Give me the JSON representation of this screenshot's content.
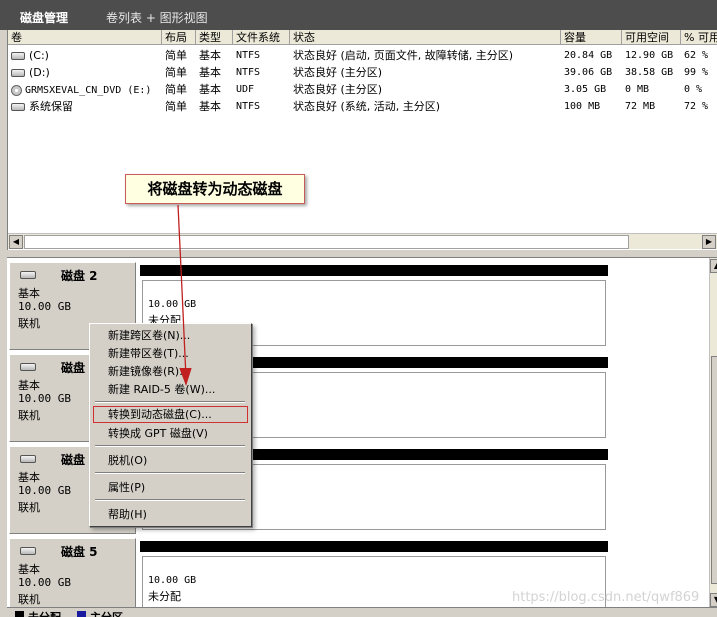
{
  "titlebar": {
    "title": "磁盘管理",
    "views": "卷列表 + 图形视图"
  },
  "columns": [
    "卷",
    "布局",
    "类型",
    "文件系统",
    "状态",
    "容量",
    "可用空间",
    "% 可用"
  ],
  "volumes": [
    {
      "icon": "drive-icon",
      "name": "(C:)",
      "layout": "简单",
      "type": "基本",
      "fs": "NTFS",
      "status": "状态良好 (启动, 页面文件, 故障转储, 主分区)",
      "capacity": "20.84 GB",
      "free": "12.90 GB",
      "pct": "62 %"
    },
    {
      "icon": "drive-icon",
      "name": "(D:)",
      "layout": "简单",
      "type": "基本",
      "fs": "NTFS",
      "status": "状态良好 (主分区)",
      "capacity": "39.06 GB",
      "free": "38.58 GB",
      "pct": "99 %"
    },
    {
      "icon": "cd-icon",
      "name": "GRMSXEVAL_CN_DVD (E:)",
      "layout": "简单",
      "type": "基本",
      "fs": "UDF",
      "status": "状态良好 (主分区)",
      "capacity": "3.05 GB",
      "free": "0 MB",
      "pct": "0 %"
    },
    {
      "icon": "drive-icon",
      "name": "系统保留",
      "layout": "简单",
      "type": "基本",
      "fs": "NTFS",
      "status": "状态良好 (系统, 活动, 主分区)",
      "capacity": "100 MB",
      "free": "72 MB",
      "pct": "72 %"
    }
  ],
  "callout": "将磁盘转为动态磁盘",
  "disks": [
    {
      "name": "磁盘 2",
      "kind": "基本",
      "size": "10.00 GB",
      "state": "联机",
      "part_size": "10.00 GB",
      "part_state": "未分配"
    },
    {
      "name": "磁盘 3",
      "kind": "基本",
      "size": "10.00 GB",
      "state": "联机",
      "part_size": "",
      "part_state": ""
    },
    {
      "name": "磁盘 4",
      "kind": "基本",
      "size": "10.00 GB",
      "state": "联机",
      "part_size": "",
      "part_state": ""
    },
    {
      "name": "磁盘 5",
      "kind": "基本",
      "size": "10.00 GB",
      "state": "联机",
      "part_size": "10.00 GB",
      "part_state": "未分配"
    }
  ],
  "context_menu": {
    "new_spanned": "新建跨区卷(N)...",
    "new_striped": "新建带区卷(T)...",
    "new_mirrored": "新建镜像卷(R)...",
    "new_raid5": "新建 RAID-5 卷(W)...",
    "convert_dynamic": "转换到动态磁盘(C)...",
    "convert_gpt": "转换成 GPT 磁盘(V)",
    "offline": "脱机(O)",
    "properties": "属性(P)",
    "help": "帮助(H)"
  },
  "legend": {
    "unallocated": "未分配",
    "primary": "主分区"
  },
  "watermark": "https://blog.csdn.net/qwf869"
}
